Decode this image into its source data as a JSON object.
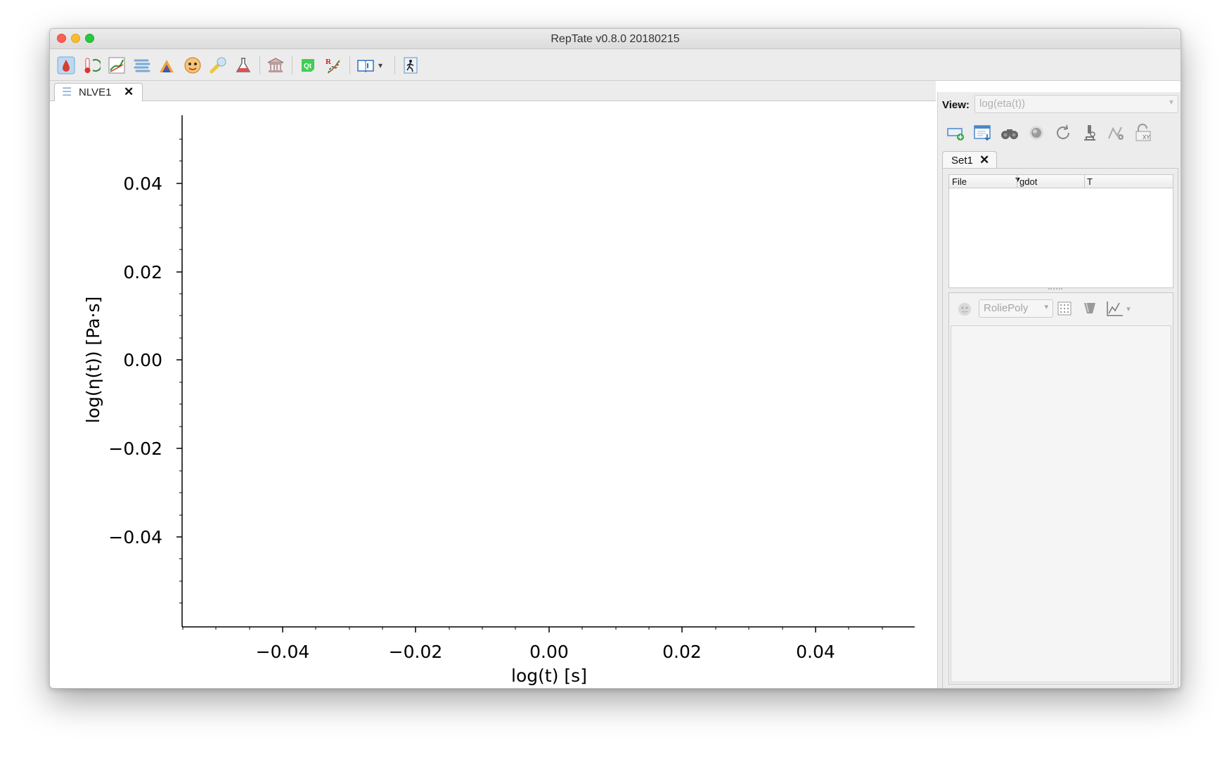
{
  "window": {
    "title": "RepTate v0.8.0 20180215"
  },
  "toolbar": {
    "icons": [
      "mwd-application-icon",
      "tts-application-icon",
      "lve-application-icon",
      "nlve-application-icon",
      "gt-application-icon",
      "creep-application-icon",
      "sans-application-icon",
      "react-application-icon",
      "dielectric-application-icon",
      "qt-about-icon",
      "reptate-logo-icon",
      "manual-icon",
      "quit-icon"
    ]
  },
  "app_tab": {
    "label": "NLVE1"
  },
  "plot": {
    "xlabel": "log(t) [s]",
    "ylabel": "log(η(t)) [Pa·s]",
    "x_ticks": [
      "−0.04",
      "−0.02",
      "0.00",
      "0.02",
      "0.04"
    ],
    "y_ticks": [
      "0.04",
      "0.02",
      "0.00",
      "−0.02",
      "−0.04"
    ]
  },
  "panel": {
    "view_label": "View:",
    "view_value": "log(eta(t))",
    "dataset_tab": "Set1",
    "columns": [
      "File",
      "gdot",
      "T"
    ],
    "theory_value": "RoliePoly"
  }
}
